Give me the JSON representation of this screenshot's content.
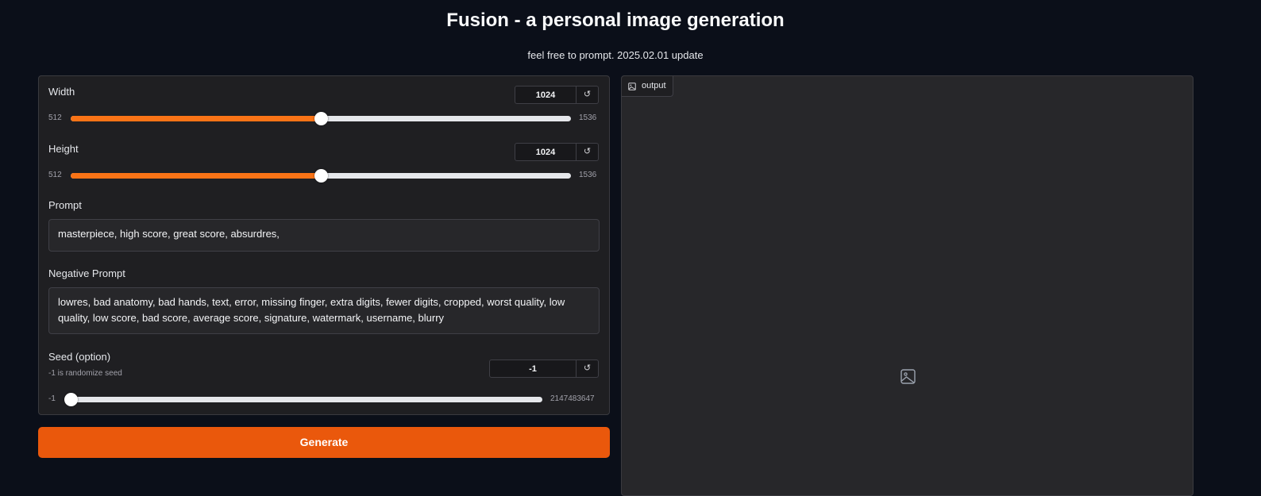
{
  "header": {
    "title": "Fusion - a personal image generation",
    "subtitle": "feel free to prompt. 2025.02.01 update"
  },
  "controls": {
    "width": {
      "label": "Width",
      "value": "1024",
      "min": "512",
      "max": "1536",
      "fraction": 0.5
    },
    "height": {
      "label": "Height",
      "value": "1024",
      "min": "512",
      "max": "1536",
      "fraction": 0.5
    },
    "prompt": {
      "label": "Prompt",
      "value": "masterpiece, high score, great score, absurdres,"
    },
    "negative_prompt": {
      "label": "Negative Prompt",
      "value": "lowres, bad anatomy, bad hands, text, error, missing finger, extra digits, fewer digits, cropped, worst quality, low quality, low score, bad score, average score, signature, watermark, username, blurry"
    },
    "seed": {
      "label": "Seed (option)",
      "hint": "-1 is randomize seed",
      "value": "-1",
      "min": "-1",
      "max": "2147483647",
      "fraction": 0.0
    },
    "reset_icon": "↺"
  },
  "actions": {
    "generate_label": "Generate"
  },
  "output": {
    "tab_label": "output",
    "tab_icon": "image-icon",
    "placeholder_icon": "image-placeholder-icon"
  },
  "colors": {
    "accent": "#f97316",
    "button": "#ea580c",
    "background": "#0b0f19",
    "panel": "#1f1f22"
  }
}
